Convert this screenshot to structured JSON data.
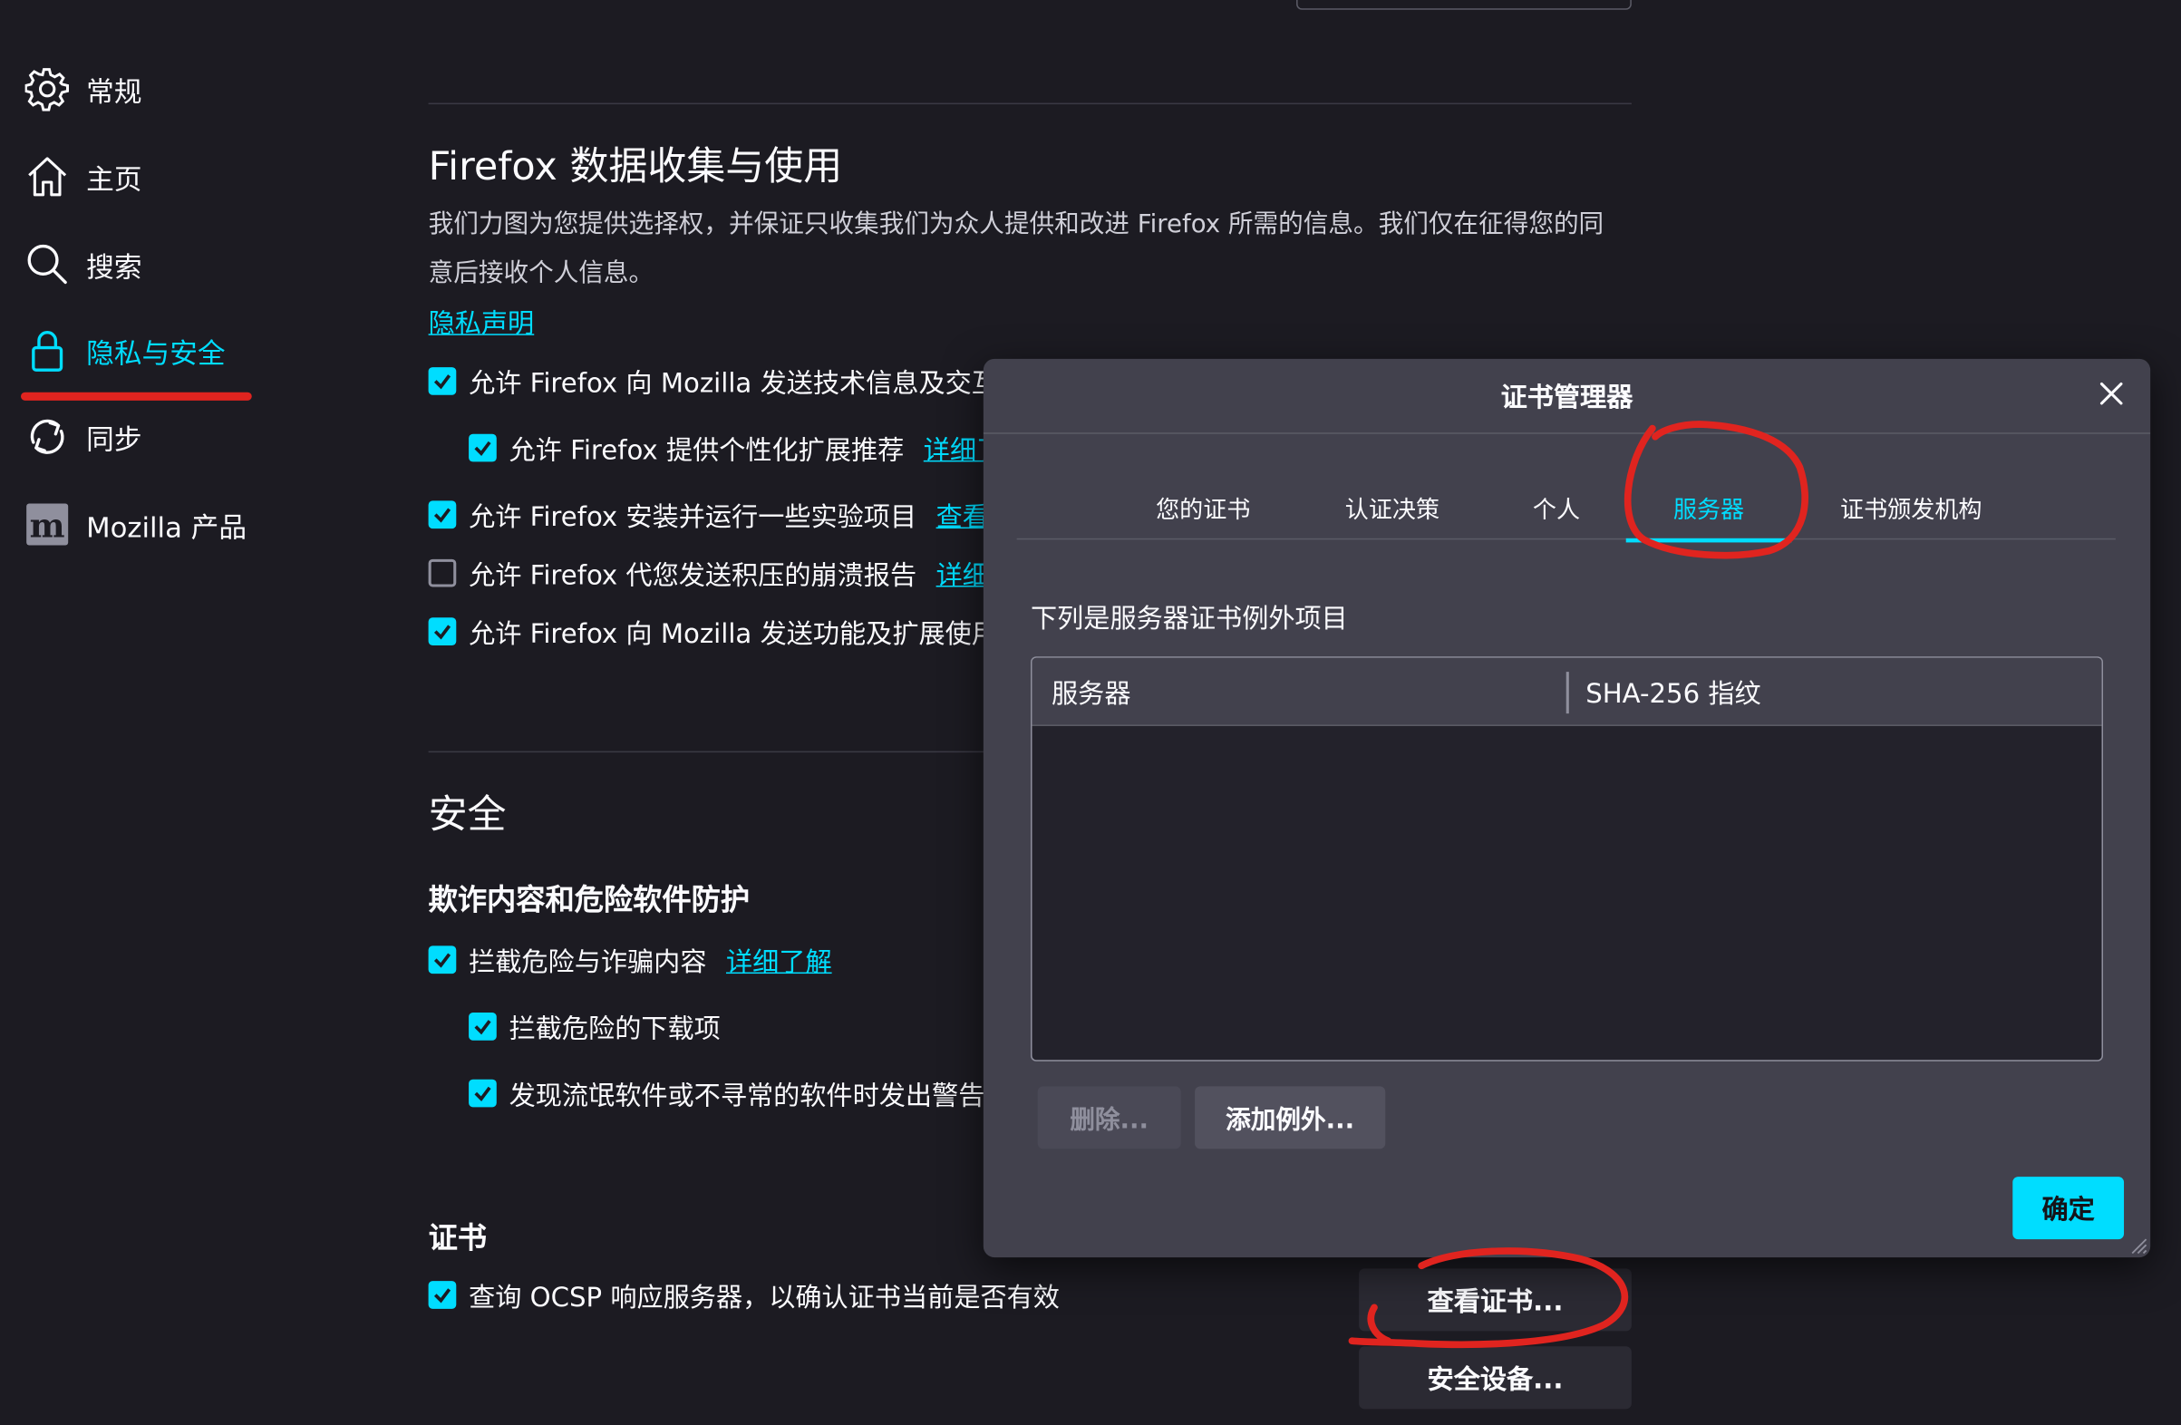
{
  "sidebar": {
    "items": [
      {
        "label": "常规",
        "icon": "gear-icon"
      },
      {
        "label": "主页",
        "icon": "home-icon"
      },
      {
        "label": "搜索",
        "icon": "search-icon"
      },
      {
        "label": "隐私与安全",
        "icon": "lock-icon",
        "active": true
      },
      {
        "label": "同步",
        "icon": "sync-icon"
      },
      {
        "label": "Mozilla 产品",
        "icon": "mozilla-logo-icon"
      }
    ]
  },
  "data_collection": {
    "title": "Firefox 数据收集与使用",
    "description": "我们力图为您提供选择权，并保证只收集我们为众人提供和改进 Firefox 所需的信息。我们仅在征得您的同意后接收个人信息。",
    "privacy_link": "隐私声明",
    "options": [
      {
        "label": "允许 Firefox 向 Mozilla 发送技术信息及交互",
        "checked": true
      },
      {
        "label": "允许 Firefox 提供个性化扩展推荐",
        "checked": true,
        "link": "详细了"
      },
      {
        "label": "允许 Firefox 安装并运行一些实验项目",
        "checked": true,
        "link": "查看"
      },
      {
        "label": "允许 Firefox 代您发送积压的崩溃报告",
        "checked": false,
        "link": "详细"
      },
      {
        "label": "允许 Firefox 向 Mozilla 发送功能及扩展使用",
        "checked": true
      }
    ]
  },
  "security": {
    "title": "安全",
    "subtitle": "欺诈内容和危险软件防护",
    "options": [
      {
        "label": "拦截危险与诈骗内容",
        "checked": true,
        "link": "详细了解"
      },
      {
        "label": "拦截危险的下载项",
        "checked": true
      },
      {
        "label": "发现流氓软件或不寻常的软件时发出警告",
        "checked": true
      }
    ]
  },
  "certificates": {
    "title": "证书",
    "ocsp_label": "查询 OCSP 响应服务器，以确认证书当前是否有效",
    "ocsp_checked": true,
    "view_button": "查看证书...",
    "devices_button": "安全设备..."
  },
  "dialog": {
    "title": "证书管理器",
    "tabs": [
      "您的证书",
      "认证决策",
      "个人",
      "服务器",
      "证书颁发机构"
    ],
    "selected_tab": "服务器",
    "intro": "下列是服务器证书例外项目",
    "columns": [
      "服务器",
      "SHA-256 指纹"
    ],
    "rows": [],
    "delete_button": "删除...",
    "add_exception_button": "添加例外...",
    "ok_button": "确定"
  },
  "colors": {
    "background": "#1c1b22",
    "accent": "#00ddff",
    "dialog": "#42414d",
    "annotation": "#e0241f"
  }
}
